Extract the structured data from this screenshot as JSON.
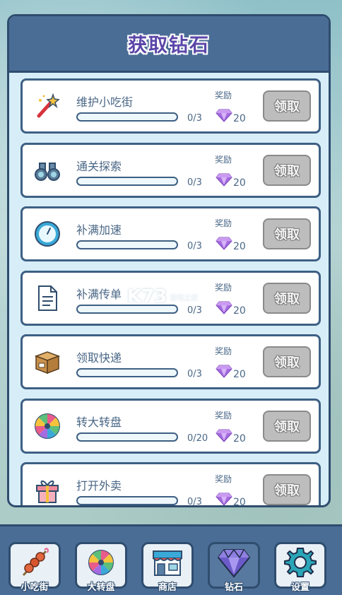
{
  "title": "获取钻石",
  "reward_label": "奖励",
  "claim_label": "领取",
  "tasks": [
    {
      "icon": "magic-wand-icon",
      "name": "维护小吃街",
      "progress": "0/3",
      "reward": "20"
    },
    {
      "icon": "binoculars-icon",
      "name": "通关探索",
      "progress": "0/3",
      "reward": "20"
    },
    {
      "icon": "clock-icon",
      "name": "补满加速",
      "progress": "0/3",
      "reward": "20"
    },
    {
      "icon": "document-icon",
      "name": "补满传单",
      "progress": "0/3",
      "reward": "20"
    },
    {
      "icon": "package-icon",
      "name": "领取快递",
      "progress": "0/3",
      "reward": "20"
    },
    {
      "icon": "wheel-icon",
      "name": "转大转盘",
      "progress": "0/20",
      "reward": "20"
    },
    {
      "icon": "gift-icon",
      "name": "打开外卖",
      "progress": "0/3",
      "reward": "20"
    }
  ],
  "tabs": [
    {
      "icon": "skewer-icon",
      "label": "小吃街",
      "active": false
    },
    {
      "icon": "wheel-icon",
      "label": "大转盘",
      "active": false
    },
    {
      "icon": "shop-icon",
      "label": "商店",
      "active": false
    },
    {
      "icon": "diamond-icon",
      "label": "钻石",
      "active": true
    },
    {
      "icon": "gear-icon",
      "label": "设置",
      "active": false
    }
  ],
  "watermark": {
    "logo": "K73",
    "text": "游戏之家"
  },
  "colors": {
    "panel_border": "#2f4d6e",
    "header": "#4a6d96",
    "gem": "#a56be0",
    "claim_disabled": "#bdbdbd"
  }
}
